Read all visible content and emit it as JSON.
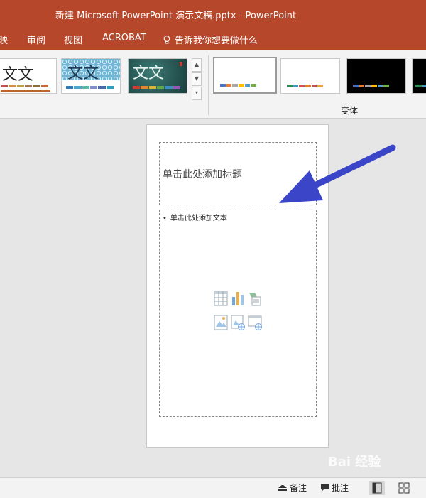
{
  "window": {
    "title": "新建 Microsoft PowerPoint 演示文稿.pptx  -  PowerPoint"
  },
  "ribbon_tabs": [
    {
      "label": "映"
    },
    {
      "label": "审阅"
    },
    {
      "label": "视图"
    },
    {
      "label": "ACROBAT"
    }
  ],
  "tell_me": {
    "label": "告诉我你想要做什么"
  },
  "themes": [
    {
      "text": "文文"
    },
    {
      "text": "文文"
    },
    {
      "text": "文文"
    }
  ],
  "variants_group": {
    "label": "变体"
  },
  "slide": {
    "title_placeholder": "单击此处添加标题",
    "body_placeholder": "单击此处添加文本"
  },
  "statusbar": {
    "notes_label": "备注",
    "comments_label": "批注"
  },
  "colors": {
    "accent": "#b7472a",
    "arrow": "#3a45c8"
  },
  "watermark": "Bai 经验"
}
